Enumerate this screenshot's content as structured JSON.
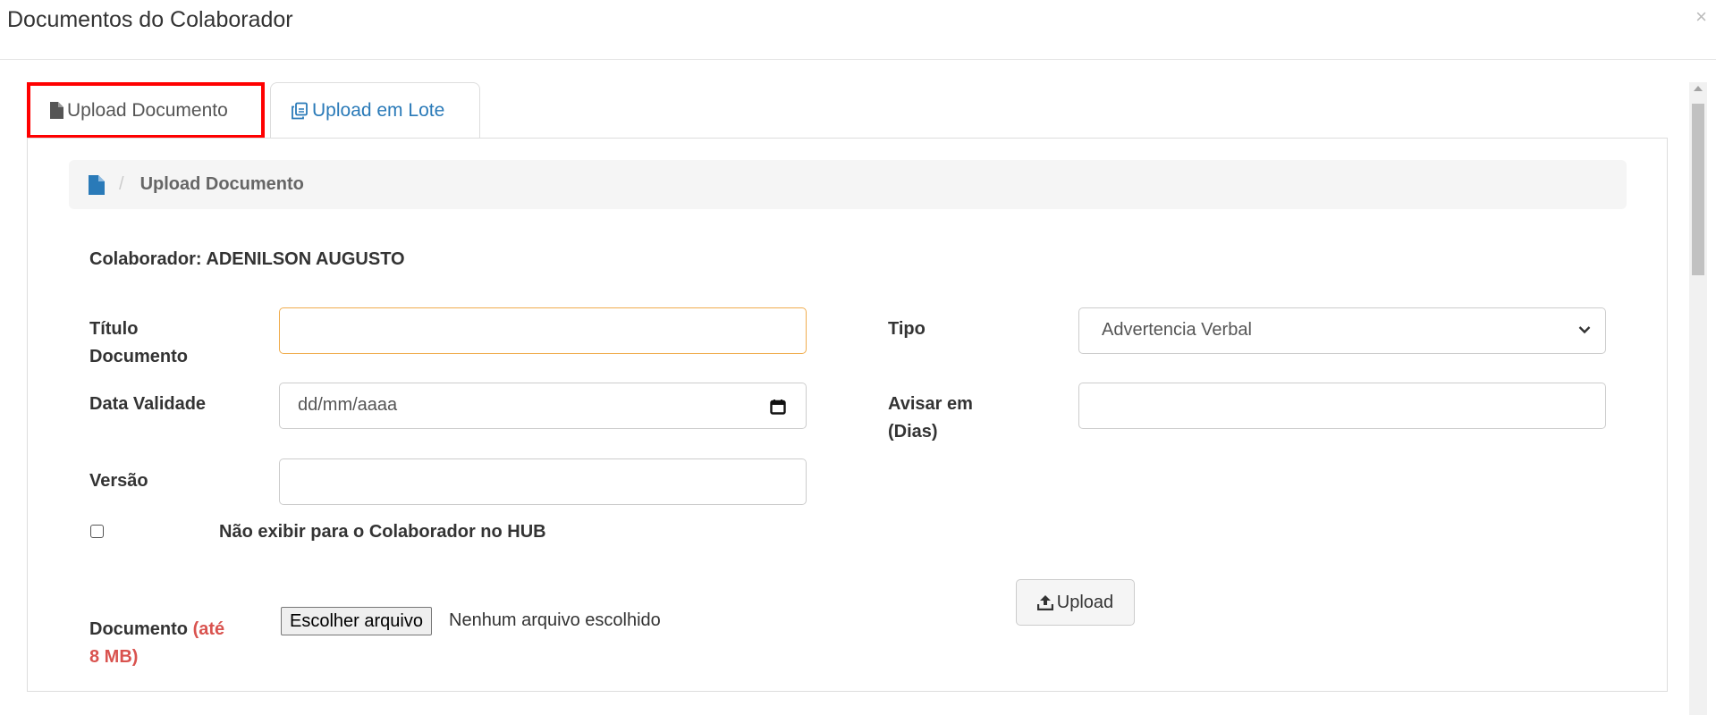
{
  "modal": {
    "title": "Documentos do Colaborador",
    "close": "×"
  },
  "tabs": [
    {
      "label": "Upload Documento",
      "icon": "file-icon",
      "active": true
    },
    {
      "label": "Upload em Lote",
      "icon": "copy-files-icon",
      "active": false
    }
  ],
  "breadcrumb": {
    "icon": "file-icon",
    "separator": "/",
    "current": "Upload Documento"
  },
  "colaborador": {
    "text": "Colaborador: ADENILSON AUGUSTO"
  },
  "form": {
    "titulo": {
      "label_line1": "Título",
      "label_line2": "Documento",
      "value": ""
    },
    "tipo": {
      "label": "Tipo",
      "selected": "Advertencia Verbal"
    },
    "data_validade": {
      "label": "Data Validade",
      "placeholder": "dd/mm/aaaa"
    },
    "avisar": {
      "label_line1": "Avisar em",
      "label_line2": "(Dias)",
      "value": ""
    },
    "versao": {
      "label": "Versão",
      "value": ""
    },
    "checkbox": {
      "label": "Não exibir para o Colaborador no HUB",
      "checked": false
    },
    "documento": {
      "label": "Documento",
      "limit_line1": "(até",
      "limit_line2": "8 MB)",
      "file_button": "Escolher arquivo",
      "file_status": "Nenhum arquivo escolhido"
    },
    "upload_button": "Upload"
  },
  "colors": {
    "accent_blue": "#2a7ab8",
    "highlight_red": "#ff0000",
    "limit_red": "#d9534f",
    "focus_orange": "#f0ad4e"
  }
}
